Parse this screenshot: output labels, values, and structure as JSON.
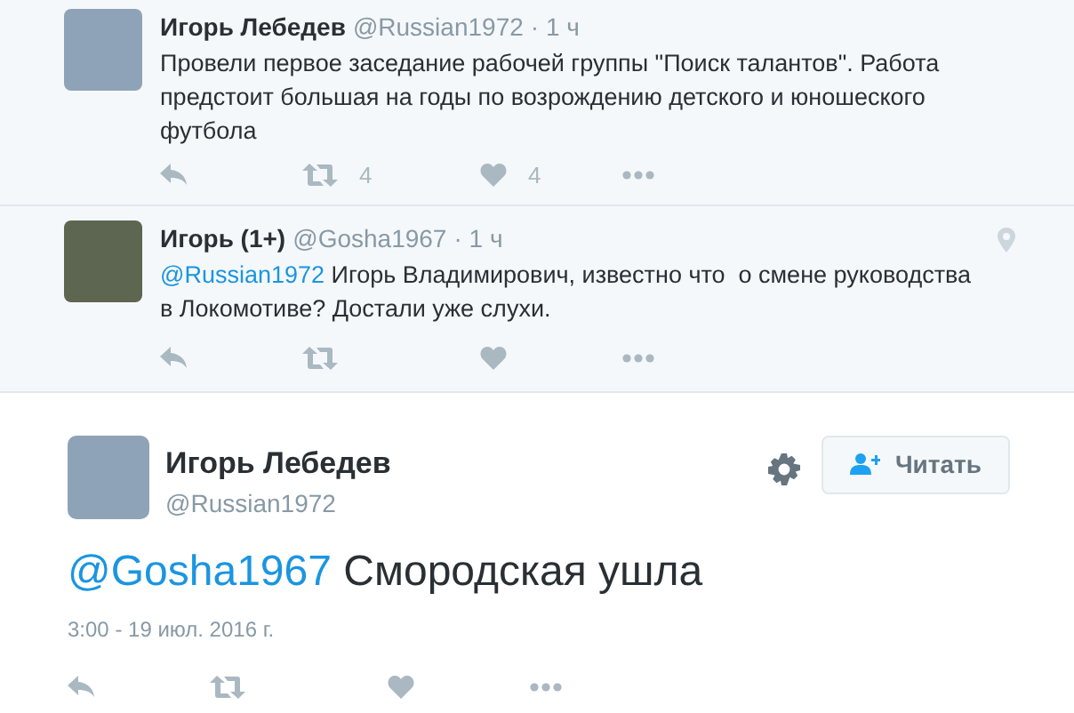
{
  "replies": [
    {
      "name": "Игорь Лебедев",
      "handle": "@Russian1972",
      "time": "· 1 ч",
      "text": "Провели первое заседание рабочей группы \"Поиск талантов\". Работа предстоит большая на годы по возрождению детского и юношеского футбола",
      "location": false,
      "actions": [
        {
          "kind": "reply"
        },
        {
          "kind": "retweet",
          "count": "4"
        },
        {
          "kind": "like",
          "count": "4"
        },
        {
          "kind": "more"
        }
      ]
    },
    {
      "name": "Игорь (1+)",
      "handle": "@Gosha1967",
      "time": "· 1 ч",
      "mention": "@Russian1972",
      "text": "Игорь Владимирович, известно что  о смене руководства в Локомотиве? Достали уже слухи.",
      "location": true,
      "actions": [
        {
          "kind": "reply"
        },
        {
          "kind": "retweet"
        },
        {
          "kind": "like"
        },
        {
          "kind": "more"
        }
      ]
    }
  ],
  "main_tweet": {
    "name": "Игорь Лебедев",
    "handle": "@Russian1972",
    "follow_button": "Читать",
    "mention": "@Gosha1967",
    "text": "Смородская ушла",
    "timestamp": "3:00 - 19 июл. 2016 г.",
    "actions": [
      {
        "kind": "reply"
      },
      {
        "kind": "retweet"
      },
      {
        "kind": "like"
      },
      {
        "kind": "more"
      }
    ]
  }
}
